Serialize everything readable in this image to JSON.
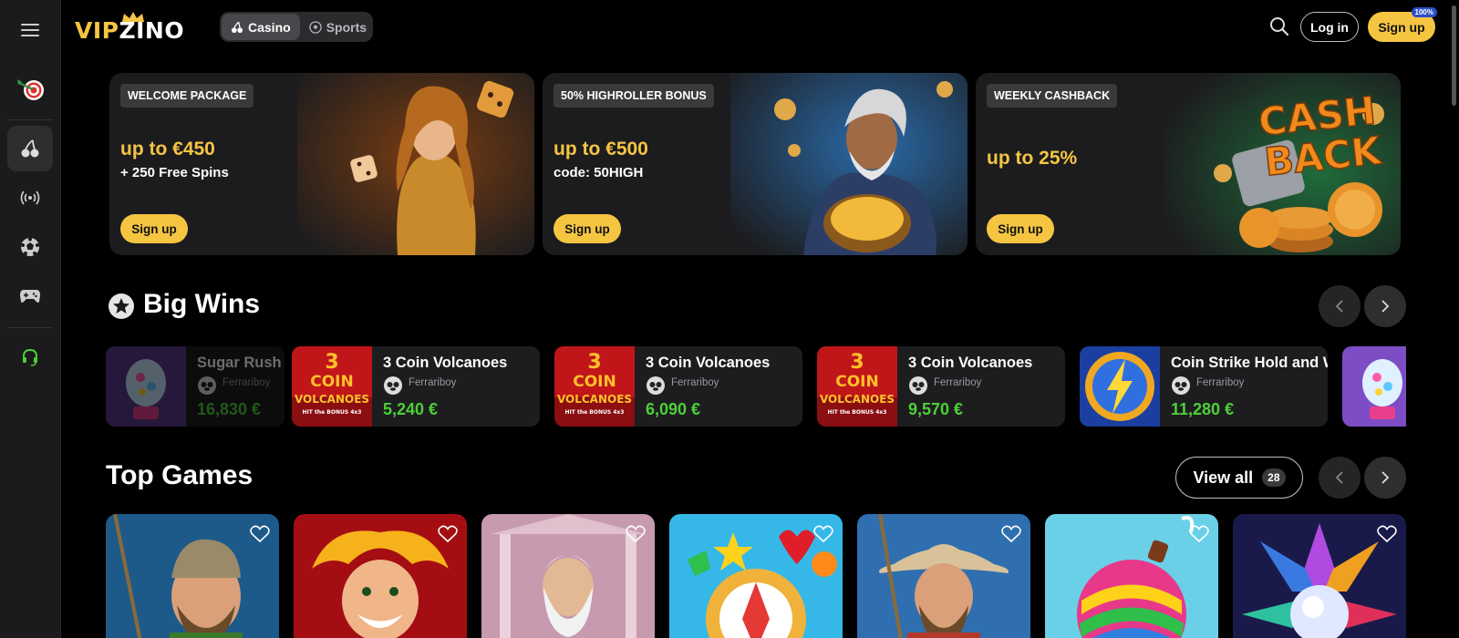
{
  "header": {
    "logo_vip": "VIP",
    "logo_zino": "ZINO",
    "modes": [
      "Casino",
      "Sports"
    ],
    "login_label": "Log in",
    "signup_label": "Sign up",
    "signup_badge": "100%"
  },
  "promos": [
    {
      "tag": "WELCOME PACKAGE",
      "title": "up to €450",
      "sub": "+ 250 Free Spins",
      "cta": "Sign up"
    },
    {
      "tag": "50% HIGHROLLER BONUS",
      "title": "up to €500",
      "sub": "code: 50HIGH",
      "cta": "Sign up"
    },
    {
      "tag": "WEEKLY CASHBACK",
      "title": "up to 25%",
      "sub": "",
      "cta": "Sign up",
      "art_text_1": "CASH",
      "art_text_2": "BACK"
    }
  ],
  "big_wins": {
    "title": "Big Wins",
    "items": [
      {
        "game": "Sugar Rush",
        "user": "Ferrariboy",
        "amount": "16,830 €"
      },
      {
        "game": "3 Coin Volcanoes",
        "user": "Ferrariboy",
        "amount": "5,240 €"
      },
      {
        "game": "3 Coin Volcanoes",
        "user": "Ferrariboy",
        "amount": "6,090 €"
      },
      {
        "game": "3 Coin Volcanoes",
        "user": "Ferrariboy",
        "amount": "9,570 €"
      },
      {
        "game": "Coin Strike Hold and W",
        "user": "Ferrariboy",
        "amount": "11,280 €"
      }
    ],
    "thumb_text": {
      "top": "3",
      "mid": "COIN",
      "bottom": "VOLCANOES",
      "tiny": "HIT the BONUS 4x3"
    }
  },
  "top_games": {
    "title": "Top Games",
    "view_all_label": "View all",
    "count": "28"
  },
  "colors": {
    "accent": "#f5c542",
    "win_green": "#4cd137",
    "sidebar_bg": "#1b1b1d"
  }
}
